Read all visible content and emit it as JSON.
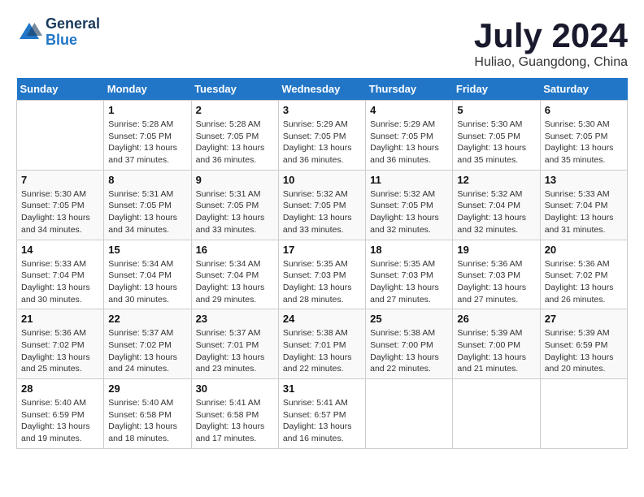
{
  "header": {
    "logo_general": "General",
    "logo_blue": "Blue",
    "month_year": "July 2024",
    "location": "Huliao, Guangdong, China"
  },
  "days_of_week": [
    "Sunday",
    "Monday",
    "Tuesday",
    "Wednesday",
    "Thursday",
    "Friday",
    "Saturday"
  ],
  "weeks": [
    [
      {
        "day": "",
        "sunrise": "",
        "sunset": "",
        "daylight": ""
      },
      {
        "day": "1",
        "sunrise": "Sunrise: 5:28 AM",
        "sunset": "Sunset: 7:05 PM",
        "daylight": "Daylight: 13 hours and 37 minutes."
      },
      {
        "day": "2",
        "sunrise": "Sunrise: 5:28 AM",
        "sunset": "Sunset: 7:05 PM",
        "daylight": "Daylight: 13 hours and 36 minutes."
      },
      {
        "day": "3",
        "sunrise": "Sunrise: 5:29 AM",
        "sunset": "Sunset: 7:05 PM",
        "daylight": "Daylight: 13 hours and 36 minutes."
      },
      {
        "day": "4",
        "sunrise": "Sunrise: 5:29 AM",
        "sunset": "Sunset: 7:05 PM",
        "daylight": "Daylight: 13 hours and 36 minutes."
      },
      {
        "day": "5",
        "sunrise": "Sunrise: 5:30 AM",
        "sunset": "Sunset: 7:05 PM",
        "daylight": "Daylight: 13 hours and 35 minutes."
      },
      {
        "day": "6",
        "sunrise": "Sunrise: 5:30 AM",
        "sunset": "Sunset: 7:05 PM",
        "daylight": "Daylight: 13 hours and 35 minutes."
      }
    ],
    [
      {
        "day": "7",
        "sunrise": "Sunrise: 5:30 AM",
        "sunset": "Sunset: 7:05 PM",
        "daylight": "Daylight: 13 hours and 34 minutes."
      },
      {
        "day": "8",
        "sunrise": "Sunrise: 5:31 AM",
        "sunset": "Sunset: 7:05 PM",
        "daylight": "Daylight: 13 hours and 34 minutes."
      },
      {
        "day": "9",
        "sunrise": "Sunrise: 5:31 AM",
        "sunset": "Sunset: 7:05 PM",
        "daylight": "Daylight: 13 hours and 33 minutes."
      },
      {
        "day": "10",
        "sunrise": "Sunrise: 5:32 AM",
        "sunset": "Sunset: 7:05 PM",
        "daylight": "Daylight: 13 hours and 33 minutes."
      },
      {
        "day": "11",
        "sunrise": "Sunrise: 5:32 AM",
        "sunset": "Sunset: 7:05 PM",
        "daylight": "Daylight: 13 hours and 32 minutes."
      },
      {
        "day": "12",
        "sunrise": "Sunrise: 5:32 AM",
        "sunset": "Sunset: 7:04 PM",
        "daylight": "Daylight: 13 hours and 32 minutes."
      },
      {
        "day": "13",
        "sunrise": "Sunrise: 5:33 AM",
        "sunset": "Sunset: 7:04 PM",
        "daylight": "Daylight: 13 hours and 31 minutes."
      }
    ],
    [
      {
        "day": "14",
        "sunrise": "Sunrise: 5:33 AM",
        "sunset": "Sunset: 7:04 PM",
        "daylight": "Daylight: 13 hours and 30 minutes."
      },
      {
        "day": "15",
        "sunrise": "Sunrise: 5:34 AM",
        "sunset": "Sunset: 7:04 PM",
        "daylight": "Daylight: 13 hours and 30 minutes."
      },
      {
        "day": "16",
        "sunrise": "Sunrise: 5:34 AM",
        "sunset": "Sunset: 7:04 PM",
        "daylight": "Daylight: 13 hours and 29 minutes."
      },
      {
        "day": "17",
        "sunrise": "Sunrise: 5:35 AM",
        "sunset": "Sunset: 7:03 PM",
        "daylight": "Daylight: 13 hours and 28 minutes."
      },
      {
        "day": "18",
        "sunrise": "Sunrise: 5:35 AM",
        "sunset": "Sunset: 7:03 PM",
        "daylight": "Daylight: 13 hours and 27 minutes."
      },
      {
        "day": "19",
        "sunrise": "Sunrise: 5:36 AM",
        "sunset": "Sunset: 7:03 PM",
        "daylight": "Daylight: 13 hours and 27 minutes."
      },
      {
        "day": "20",
        "sunrise": "Sunrise: 5:36 AM",
        "sunset": "Sunset: 7:02 PM",
        "daylight": "Daylight: 13 hours and 26 minutes."
      }
    ],
    [
      {
        "day": "21",
        "sunrise": "Sunrise: 5:36 AM",
        "sunset": "Sunset: 7:02 PM",
        "daylight": "Daylight: 13 hours and 25 minutes."
      },
      {
        "day": "22",
        "sunrise": "Sunrise: 5:37 AM",
        "sunset": "Sunset: 7:02 PM",
        "daylight": "Daylight: 13 hours and 24 minutes."
      },
      {
        "day": "23",
        "sunrise": "Sunrise: 5:37 AM",
        "sunset": "Sunset: 7:01 PM",
        "daylight": "Daylight: 13 hours and 23 minutes."
      },
      {
        "day": "24",
        "sunrise": "Sunrise: 5:38 AM",
        "sunset": "Sunset: 7:01 PM",
        "daylight": "Daylight: 13 hours and 22 minutes."
      },
      {
        "day": "25",
        "sunrise": "Sunrise: 5:38 AM",
        "sunset": "Sunset: 7:00 PM",
        "daylight": "Daylight: 13 hours and 22 minutes."
      },
      {
        "day": "26",
        "sunrise": "Sunrise: 5:39 AM",
        "sunset": "Sunset: 7:00 PM",
        "daylight": "Daylight: 13 hours and 21 minutes."
      },
      {
        "day": "27",
        "sunrise": "Sunrise: 5:39 AM",
        "sunset": "Sunset: 6:59 PM",
        "daylight": "Daylight: 13 hours and 20 minutes."
      }
    ],
    [
      {
        "day": "28",
        "sunrise": "Sunrise: 5:40 AM",
        "sunset": "Sunset: 6:59 PM",
        "daylight": "Daylight: 13 hours and 19 minutes."
      },
      {
        "day": "29",
        "sunrise": "Sunrise: 5:40 AM",
        "sunset": "Sunset: 6:58 PM",
        "daylight": "Daylight: 13 hours and 18 minutes."
      },
      {
        "day": "30",
        "sunrise": "Sunrise: 5:41 AM",
        "sunset": "Sunset: 6:58 PM",
        "daylight": "Daylight: 13 hours and 17 minutes."
      },
      {
        "day": "31",
        "sunrise": "Sunrise: 5:41 AM",
        "sunset": "Sunset: 6:57 PM",
        "daylight": "Daylight: 13 hours and 16 minutes."
      },
      {
        "day": "",
        "sunrise": "",
        "sunset": "",
        "daylight": ""
      },
      {
        "day": "",
        "sunrise": "",
        "sunset": "",
        "daylight": ""
      },
      {
        "day": "",
        "sunrise": "",
        "sunset": "",
        "daylight": ""
      }
    ]
  ]
}
